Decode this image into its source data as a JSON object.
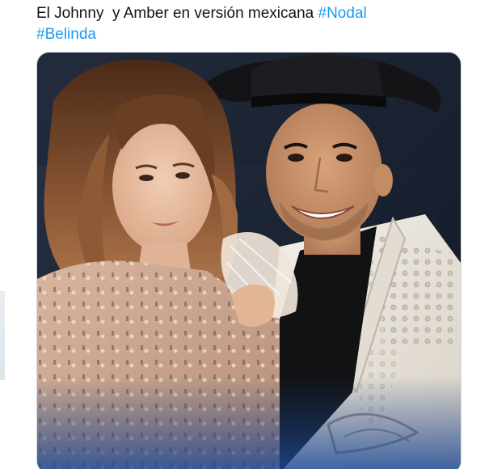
{
  "tweet": {
    "text_part1": "El Johnny  y Amber en versión mexicana ",
    "hashtag1": "#Nodal",
    "hashtag2": "#Belinda"
  },
  "media": {
    "description_icon": "photo",
    "colors": {
      "background_dark": "#1b2433",
      "jacket_white": "#eae5dd",
      "hat_black": "#141416",
      "hair_brown": "#7a4a2c",
      "dress_nude": "#c8a48c",
      "hashtag_blue": "#1d9bf0"
    }
  }
}
